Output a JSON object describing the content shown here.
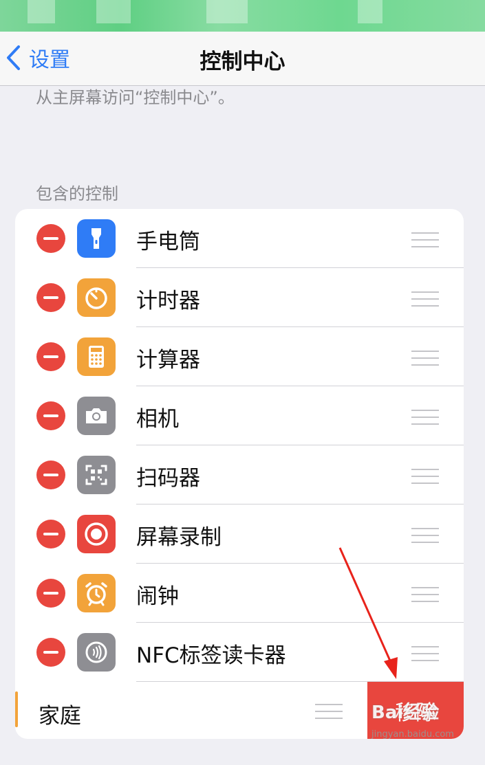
{
  "nav": {
    "back_label": "设置",
    "title": "控制中心"
  },
  "description": "从主屏幕访问“控制中心”。",
  "section_header": "包含的控制",
  "controls": [
    {
      "label": "手电筒",
      "icon": "flashlight-icon",
      "color": "#2f7cf6"
    },
    {
      "label": "计时器",
      "icon": "timer-icon",
      "color": "#f2a33a"
    },
    {
      "label": "计算器",
      "icon": "calculator-icon",
      "color": "#f2a33a"
    },
    {
      "label": "相机",
      "icon": "camera-icon",
      "color": "#8e8e93"
    },
    {
      "label": "扫码器",
      "icon": "qr-scanner-icon",
      "color": "#8e8e93"
    },
    {
      "label": "屏幕录制",
      "icon": "screen-record-icon",
      "color": "#e8463e"
    },
    {
      "label": "闹钟",
      "icon": "alarm-clock-icon",
      "color": "#f2a33a"
    },
    {
      "label": "NFC标签读卡器",
      "icon": "nfc-icon",
      "color": "#8e8e93"
    }
  ],
  "swiped_item": {
    "label": "家庭",
    "action_label": "移除"
  },
  "watermark": {
    "brand": "Bai经验",
    "url": "jingyan.baidu.com"
  },
  "colors": {
    "accent_blue": "#2f7cf6",
    "delete_red": "#e8463e",
    "background": "#efeff4"
  }
}
